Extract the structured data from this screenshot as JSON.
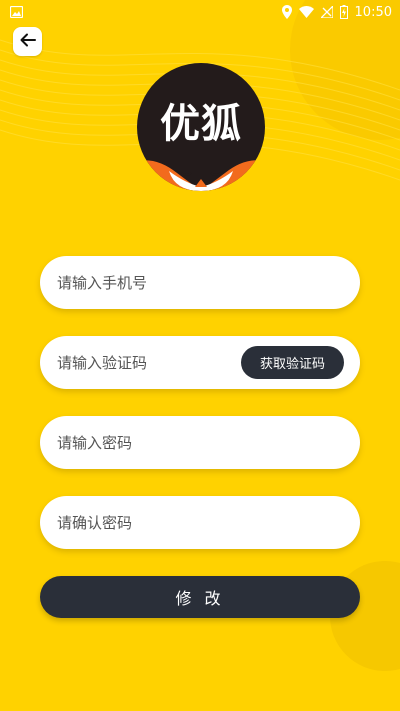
{
  "status_bar": {
    "time": "10:50",
    "icons": [
      "image-icon",
      "location-icon",
      "wifi-icon",
      "signal-icon",
      "battery-icon"
    ]
  },
  "header": {
    "back_icon": "arrow-left-icon"
  },
  "logo": {
    "text": "优狐"
  },
  "form": {
    "phone_placeholder": "请输入手机号",
    "code_placeholder": "请输入验证码",
    "get_code_label": "获取验证码",
    "password_placeholder": "请输入密码",
    "confirm_password_placeholder": "请确认密码",
    "submit_label": "修 改"
  },
  "colors": {
    "background": "#FFD200",
    "button_dark": "#2A2F39",
    "field_bg": "#FFFFFF"
  }
}
